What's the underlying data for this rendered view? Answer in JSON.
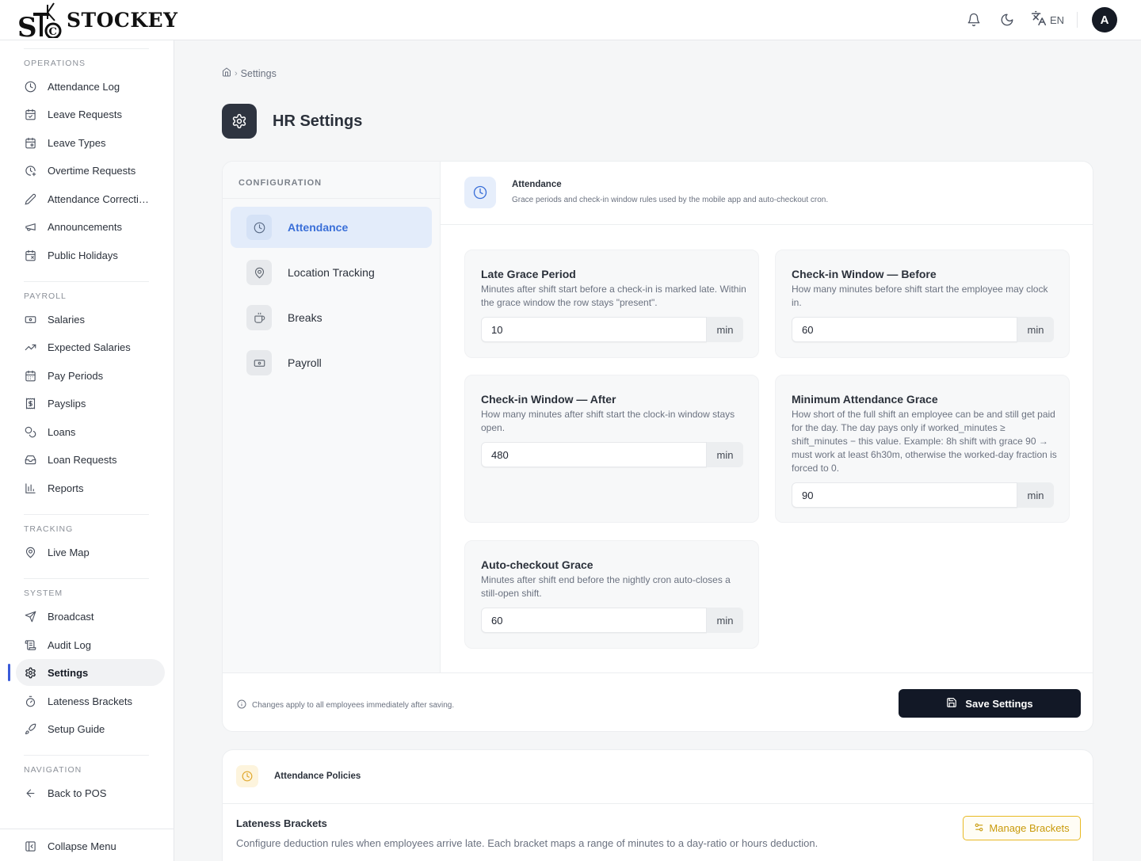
{
  "brand": {
    "name": "STOCKEY",
    "mark": "STC"
  },
  "topbar": {
    "lang_code": "EN",
    "avatar_initial": "A"
  },
  "sidebar": {
    "sections": [
      {
        "label": "OPERATIONS",
        "items": [
          {
            "label": "Attendance Log",
            "icon": "clock-icon"
          },
          {
            "label": "Leave Requests",
            "icon": "calendar-check-icon"
          },
          {
            "label": "Leave Types",
            "icon": "calendar-cog-icon"
          },
          {
            "label": "Overtime Requests",
            "icon": "clock-plus-icon"
          },
          {
            "label": "Attendance Correcti…",
            "icon": "pencil-icon"
          },
          {
            "label": "Announcements",
            "icon": "megaphone-icon"
          },
          {
            "label": "Public Holidays",
            "icon": "calendar-x-icon"
          }
        ]
      },
      {
        "label": "PAYROLL",
        "items": [
          {
            "label": "Salaries",
            "icon": "banknote-icon"
          },
          {
            "label": "Expected Salaries",
            "icon": "trending-up-icon"
          },
          {
            "label": "Pay Periods",
            "icon": "calendar-icon"
          },
          {
            "label": "Payslips",
            "icon": "receipt-icon"
          },
          {
            "label": "Loans",
            "icon": "coins-icon"
          },
          {
            "label": "Loan Requests",
            "icon": "inbox-icon"
          },
          {
            "label": "Reports",
            "icon": "bar-chart-icon"
          }
        ]
      },
      {
        "label": "TRACKING",
        "items": [
          {
            "label": "Live Map",
            "icon": "map-pin-icon"
          }
        ]
      },
      {
        "label": "SYSTEM",
        "items": [
          {
            "label": "Broadcast",
            "icon": "send-icon"
          },
          {
            "label": "Audit Log",
            "icon": "scroll-icon"
          },
          {
            "label": "Settings",
            "icon": "gear-icon",
            "active": true
          },
          {
            "label": "Lateness Brackets",
            "icon": "timer-icon"
          },
          {
            "label": "Setup Guide",
            "icon": "rocket-icon"
          }
        ]
      },
      {
        "label": "NAVIGATION",
        "items": [
          {
            "label": "Back to POS",
            "icon": "arrow-left-icon"
          }
        ]
      }
    ],
    "collapse_label": "Collapse Menu"
  },
  "breadcrumb": {
    "current": "Settings"
  },
  "page": {
    "title": "HR Settings"
  },
  "config": {
    "title": "CONFIGURATION",
    "items": [
      {
        "label": "Attendance",
        "icon": "clock-icon",
        "active": true
      },
      {
        "label": "Location Tracking",
        "icon": "map-pin-icon"
      },
      {
        "label": "Breaks",
        "icon": "coffee-icon"
      },
      {
        "label": "Payroll",
        "icon": "banknote-icon"
      }
    ]
  },
  "panel": {
    "title": "Attendance",
    "subtitle": "Grace periods and check-in window rules used by the mobile app and auto-checkout cron."
  },
  "fields": {
    "late_grace": {
      "title": "Late Grace Period",
      "desc": "Minutes after shift start before a check-in is marked late. Within the grace window the row stays \"present\".",
      "value": "10",
      "unit": "min"
    },
    "window_before": {
      "title": "Check-in Window — Before",
      "desc": "How many minutes before shift start the employee may clock in.",
      "value": "60",
      "unit": "min"
    },
    "window_after": {
      "title": "Check-in Window — After",
      "desc": "How many minutes after shift start the clock-in window stays open.",
      "value": "480",
      "unit": "min"
    },
    "min_grace": {
      "title": "Minimum Attendance Grace",
      "desc": "How short of the full shift an employee can be and still get paid for the day. The day pays only if worked_minutes ≥ shift_minutes − this value. Example: 8h shift with grace 90 → must work at least 6h30m, otherwise the worked-day fraction is forced to 0.",
      "value": "90",
      "unit": "min"
    },
    "auto_checkout": {
      "title": "Auto-checkout Grace",
      "desc": "Minutes after shift end before the nightly cron auto-closes a still-open shift.",
      "value": "60",
      "unit": "min"
    }
  },
  "footer": {
    "note": "Changes apply to all employees immediately after saving.",
    "save_label": "Save Settings"
  },
  "policies": {
    "title": "Attendance Policies",
    "lateness_title": "Lateness Brackets",
    "lateness_desc": "Configure deduction rules when employees arrive late. Each bracket maps a range of minutes to a day-ratio or hours deduction.",
    "manage_label": "Manage Brackets"
  },
  "colors": {
    "accent": "#3a6fd8",
    "primary_button": "#121826",
    "warning": "#e8b923"
  }
}
